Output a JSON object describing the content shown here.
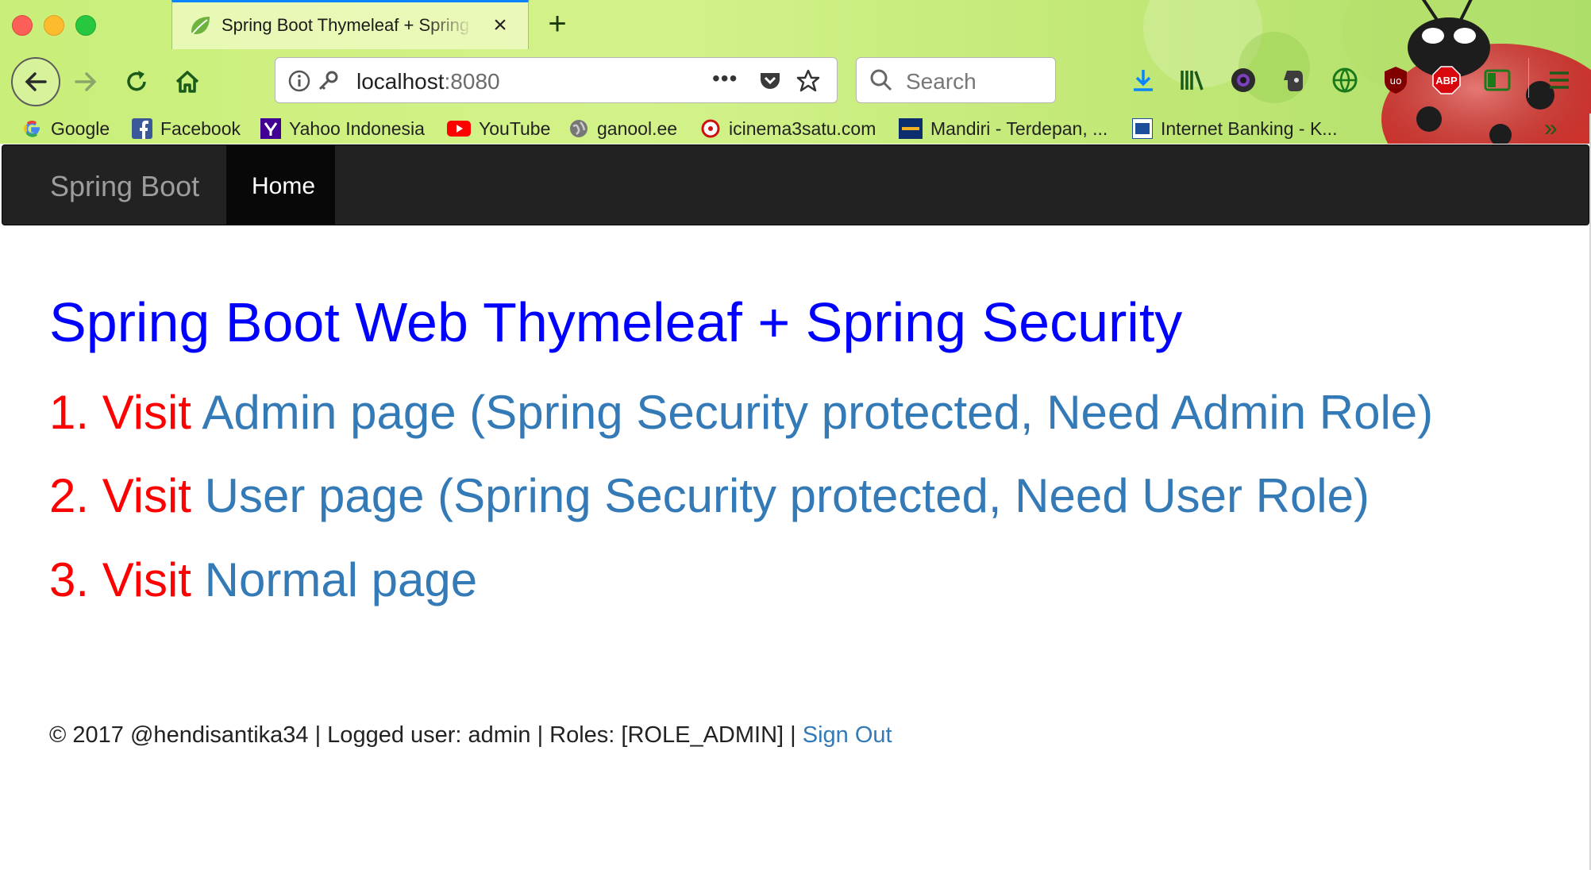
{
  "browser": {
    "tab_title": "Spring Boot Thymeleaf + Spring Security",
    "url_host": "localhost",
    "url_port": ":8080",
    "search_placeholder": "Search",
    "bookmarks": [
      "Google",
      "Facebook",
      "Yahoo Indonesia",
      "YouTube",
      "ganool.ee",
      "icinema3satu.com",
      "Mandiri - Terdepan, ...",
      "Internet Banking - K..."
    ],
    "toolbar_icons": [
      "downloads-icon",
      "library-icon",
      "camera-icon",
      "evernote-icon",
      "globe-icon",
      "ublock-icon",
      "adblock-plus-icon",
      "sidebar-icon",
      "menu-icon"
    ],
    "adblock_label": "ABP",
    "ublock_label": "uo"
  },
  "navbar": {
    "brand": "Spring Boot",
    "home": "Home"
  },
  "main": {
    "heading": "Spring Boot Web Thymeleaf + Spring Security",
    "items": [
      {
        "prefix": "1. Visit",
        "link": "Admin page (Spring Security protected, Need Admin Role)"
      },
      {
        "prefix": "2. Visit",
        "link": "User page (Spring Security protected, Need User Role)"
      },
      {
        "prefix": "3. Visit",
        "link": "Normal page"
      }
    ]
  },
  "footer": {
    "text": "© 2017 @hendisantika34 | Logged user: admin | Roles: [ROLE_ADMIN] |",
    "signout": "Sign Out"
  },
  "colors": {
    "heading": "#0000ff",
    "visit": "#ff0000",
    "link": "#337ab7",
    "navbar_bg": "#222222"
  }
}
